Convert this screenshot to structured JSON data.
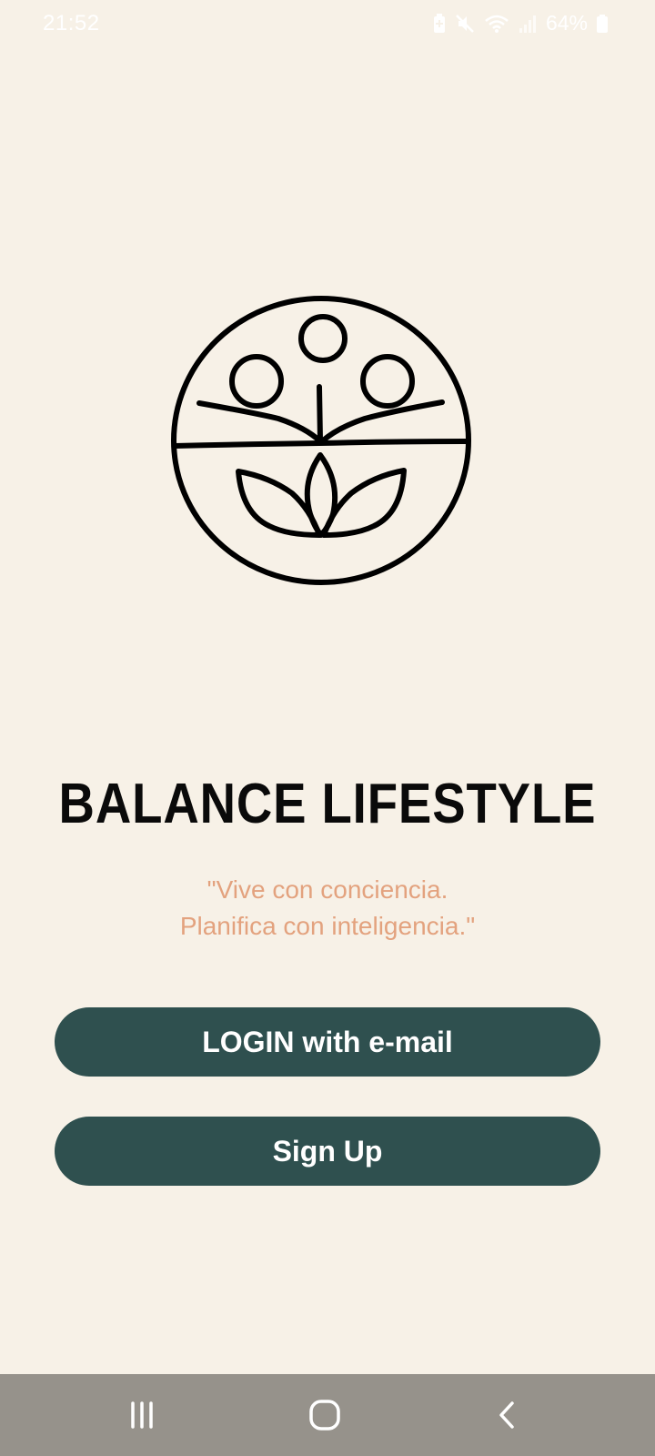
{
  "status_bar": {
    "time": "21:52",
    "battery_percent": "64%",
    "icons": [
      "battery-saver-icon",
      "mute-icon",
      "wifi-icon",
      "signal-icon",
      "battery-icon"
    ]
  },
  "logo": {
    "icon": "balance-lifestyle-logo-icon"
  },
  "app": {
    "title": "BALANCE LIFESTYLE",
    "tagline_line1": "\"Vive con conciencia.",
    "tagline_line2": "Planifica con inteligencia.\""
  },
  "buttons": {
    "login_label": "LOGIN with e-mail",
    "signup_label": "Sign Up"
  },
  "nav_bar": {
    "icons": [
      "recents-icon",
      "home-icon",
      "back-icon"
    ]
  },
  "colors": {
    "background": "#F7F1E7",
    "button": "#2F504F",
    "tagline": "#E3A27E",
    "nav_bar": "#96928B"
  }
}
